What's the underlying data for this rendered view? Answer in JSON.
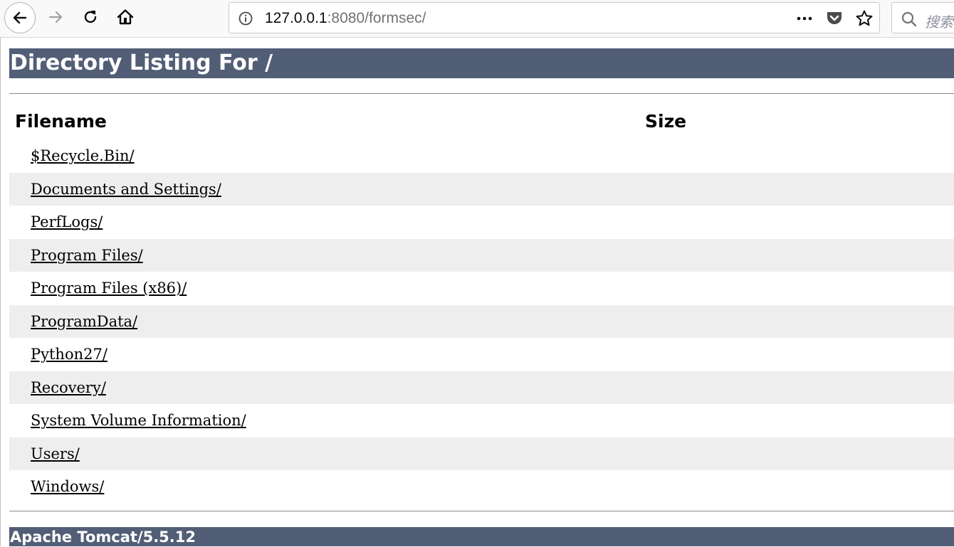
{
  "browser": {
    "url": {
      "host": "127.0.0.1",
      "rest": ":8080/formsec/"
    },
    "search_placeholder": "搜索",
    "icons": [
      "back-arrow-icon",
      "forward-arrow-icon",
      "reload-icon",
      "home-icon",
      "info-icon",
      "more-icon",
      "pocket-icon",
      "star-icon",
      "search-icon"
    ]
  },
  "page": {
    "heading": "Directory Listing For /",
    "columns": {
      "filename": "Filename",
      "size": "Size"
    },
    "files": [
      "$Recycle.Bin/",
      "Documents and Settings/",
      "PerfLogs/",
      "Program Files/",
      "Program Files (x86)/",
      "ProgramData/",
      "Python27/",
      "Recovery/",
      "System Volume Information/",
      "Users/",
      "Windows/"
    ],
    "footer": "Apache Tomcat/5.5.12"
  },
  "colors": {
    "header_bg": "#525d76",
    "alt_row_bg": "#eeeeee"
  }
}
